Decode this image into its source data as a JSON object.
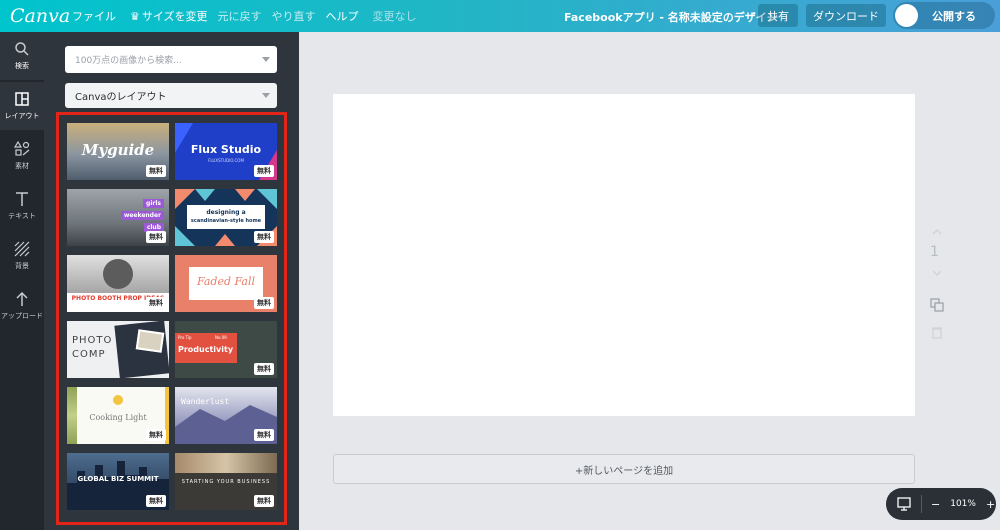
{
  "topbar": {
    "logo": "Canva",
    "menu": {
      "file": "ファイル",
      "resize": "サイズを変更",
      "undo": "元に戻す",
      "redo": "やり直す",
      "help": "ヘルプ",
      "status": "変更なし"
    },
    "doc_title": "Facebookアプリ - 名称未設定のデザイン",
    "share": "共有",
    "download": "ダウンロード",
    "publish": "公開する"
  },
  "rail": {
    "search": "検索",
    "layout": "レイアウト",
    "elements": "素材",
    "text": "テキスト",
    "background": "背景",
    "upload": "アップロード"
  },
  "panel": {
    "search_placeholder": "100万点の画像から検索...",
    "dropdown_value": "Canvaのレイアウト"
  },
  "templates": [
    {
      "title": "Myguide",
      "badge": "無料"
    },
    {
      "title": "Flux Studio",
      "subtitle": "FLUXSTUDIO.COM",
      "badge": "無料"
    },
    {
      "line1": "girls",
      "line2": "weekender",
      "line3": "club",
      "badge": "無料"
    },
    {
      "line1": "designing a",
      "line2": "scandinavian-style home",
      "badge": "無料"
    },
    {
      "title": "PHOTO BOOTH PROP IDEAS",
      "badge": "無料"
    },
    {
      "title": "Faded Fall",
      "badge": "無料"
    },
    {
      "line1": "PHOTO",
      "line2": "COMP",
      "badge": ""
    },
    {
      "tag": "Pro Tip",
      "no": "No.09",
      "title": "Productivity",
      "badge": "無料"
    },
    {
      "title": "Cooking Light",
      "badge": "無料"
    },
    {
      "title": "Wanderlust",
      "badge": "無料"
    },
    {
      "title": "GLOBAL BIZ SUMMIT",
      "badge": "無料"
    },
    {
      "title": "STARTING YOUR BUSINESS",
      "badge": "無料"
    }
  ],
  "canvas": {
    "page_number": "1",
    "add_page": "+新しいページを追加"
  },
  "zoom": {
    "minus": "−",
    "value": "101%",
    "plus": "+"
  },
  "colors": {
    "accent": "#00c4cc",
    "highlight_border": "#e32418",
    "rail_bg": "#22272d",
    "panel_bg": "#2f353c"
  }
}
